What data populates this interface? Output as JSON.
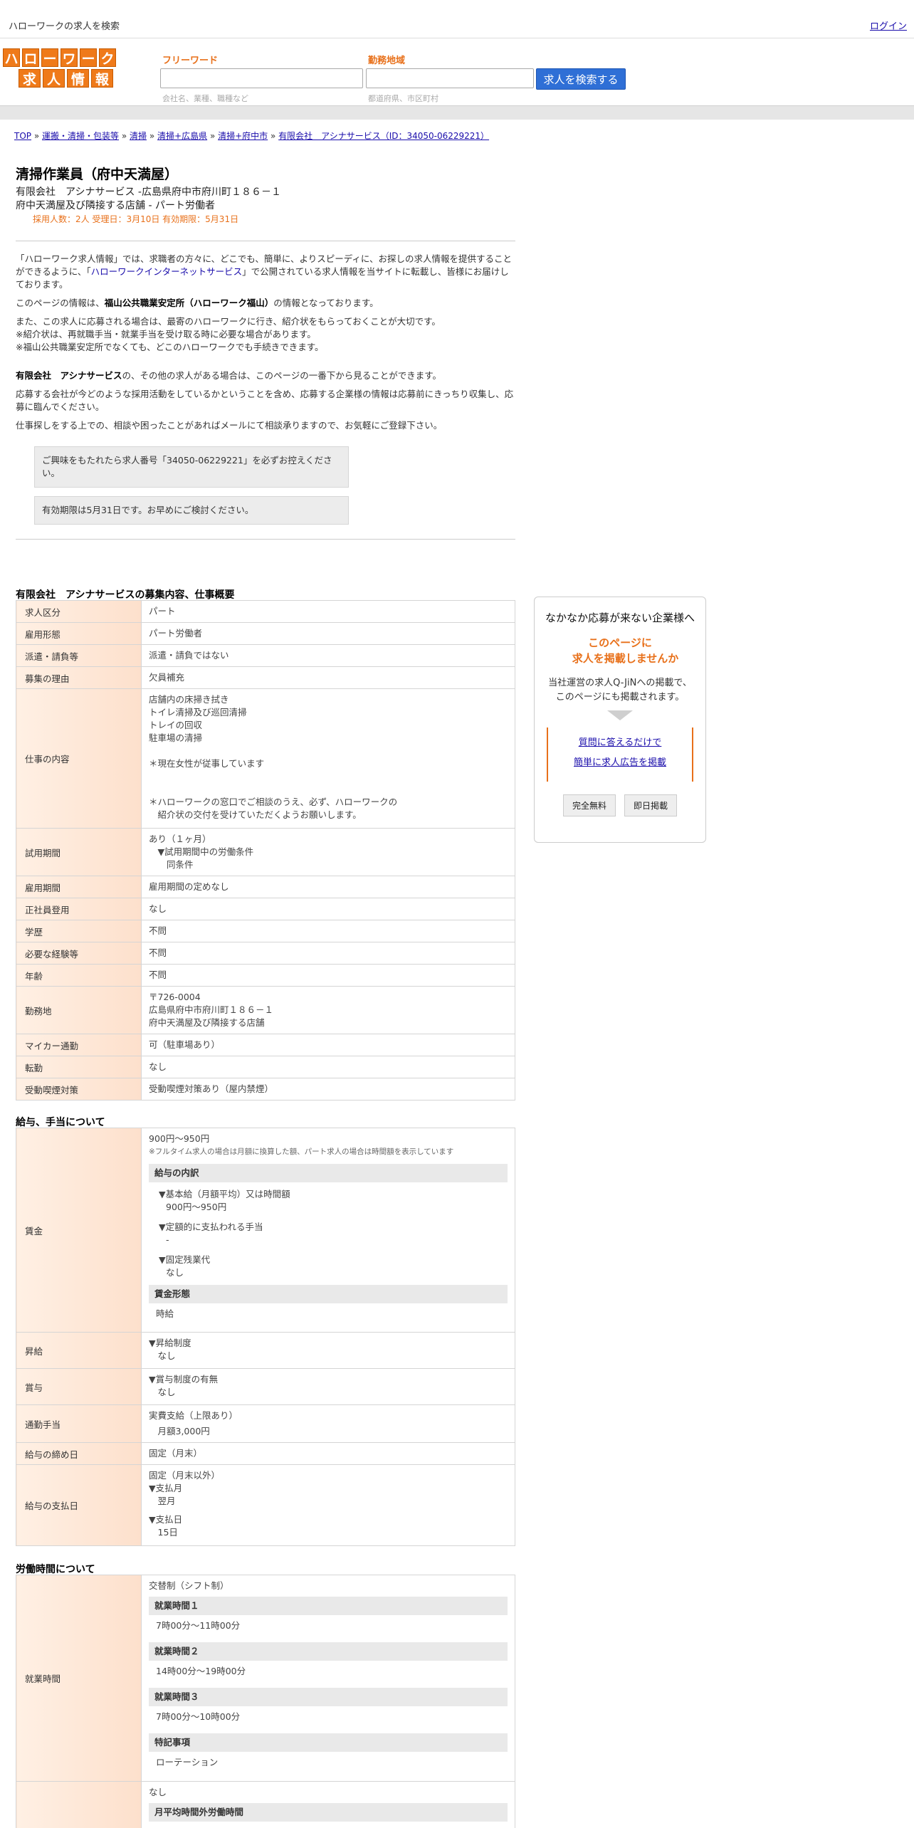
{
  "topbar": {
    "site_title": "ハローワークの求人を検索",
    "login": "ログイン"
  },
  "logo": {
    "row1": [
      "ハ",
      "ロ",
      "ー",
      "ワ",
      "ー",
      "ク"
    ],
    "row2": [
      "求",
      "人",
      "情",
      "報"
    ]
  },
  "search": {
    "keyword_label": "フリーワード",
    "keyword_placeholder": "会社名、業種、職種など",
    "area_label": "勤務地域",
    "area_placeholder": "都道府県、市区町村",
    "button": "求人を検索する"
  },
  "breadcrumb": {
    "items": [
      "TOP",
      "運搬・清掃・包装等",
      "清掃",
      "清掃+広島県",
      "清掃+府中市",
      "有限会社　アシナサービス（ID：34050-06229221）"
    ],
    "sep": "»"
  },
  "job": {
    "title": "清掃作業員（府中天満屋）",
    "company_line": "有限会社　アシナサービス -広島県府中市府川町１８６－１",
    "workplace_line": "府中天満屋及び隣接する店舗 - パート労働者",
    "meta": "採用人数：2人  受理日：3月10日  有効期限：5月31日"
  },
  "intro": {
    "p1_a": "「ハローワーク求人情報」では、求職者の方々に、どこでも、簡単に、よりスピーディに、お探しの求人情報を提供することができるように、「",
    "p1_link": "ハローワークインターネットサービス",
    "p1_b": "」で公開されている求人情報を当サイトに転載し、皆様にお届けしております。",
    "p2_a": "このページの情報は、",
    "p2_b": "福山公共職業安定所（ハローワーク福山）",
    "p2_c": "の情報となっております。",
    "p3_1": "また、この求人に応募される場合は、最寄のハローワークに行き、紹介状をもらっておくことが大切です。",
    "p3_2": "※紹介状は、再就職手当・就業手当を受け取る時に必要な場合があります。",
    "p3_3": "※福山公共職業安定所でなくても、どこのハローワークでも手続きできます。",
    "p4_a": "有限会社　アシナサービス",
    "p4_b": "の、その他の求人がある場合は、このページの一番下から見ることができます。",
    "p5": "応募する会社が今どのような採用活動をしているかということを含め、応募する企業様の情報は応募前にきっちり収集し、応募に臨んでください。",
    "p6": "仕事探しをする上での、相談や困ったことがあればメールにて相談承りますので、お気軽にご登録下さい。",
    "notice1": "ご興味をもたれたら求人番号「34050-06229221」を必ずお控えください。",
    "notice2": "有効期限は5月31日です。お早めにご検討ください。"
  },
  "summary": {
    "title": "有限会社　アシナサービスの募集内容、仕事概要",
    "rows": [
      {
        "label": "求人区分",
        "value": "パート"
      },
      {
        "label": "雇用形態",
        "value": "パート労働者"
      },
      {
        "label": "派遣・請負等",
        "value": "派遣・請負ではない"
      },
      {
        "label": "募集の理由",
        "value": "欠員補充"
      },
      {
        "label": "仕事の内容",
        "lines": [
          "店舗内の床掃き拭き",
          "トイレ清掃及び巡回清掃",
          "トレイの回収",
          "駐車場の清掃",
          "",
          "＊現在女性が従事しています",
          "",
          "",
          "＊ハローワークの窓口でご相談のうえ、必ず、ハローワークの",
          "　紹介状の交付を受けていただくようお願いします。"
        ]
      },
      {
        "label": "試用期間",
        "lines": [
          "あり（１ヶ月）",
          "　▼試用期間中の労働条件",
          "　　同条件"
        ]
      },
      {
        "label": "雇用期間",
        "value": "雇用期間の定めなし"
      },
      {
        "label": "正社員登用",
        "value": "なし"
      },
      {
        "label": "学歴",
        "value": "不問"
      },
      {
        "label": "必要な経験等",
        "value": "不問"
      },
      {
        "label": "年齢",
        "value": "不問"
      },
      {
        "label": "勤務地",
        "lines": [
          "〒726-0004",
          "広島県府中市府川町１８６－１",
          "府中天満屋及び隣接する店舗"
        ]
      },
      {
        "label": "マイカー通勤",
        "value": "可（駐車場あり）"
      },
      {
        "label": "転勤",
        "value": "なし"
      },
      {
        "label": "受動喫煙対策",
        "value": "受動喫煙対策あり（屋内禁煙）"
      }
    ]
  },
  "salary": {
    "title": "給与、手当について",
    "wage_label": "賃金",
    "wage_value": "900円〜950円",
    "wage_note": "※フルタイム求人の場合は月額に換算した額、パート求人の場合は時間額を表示しています",
    "breakdown_hdr": "給与の内訳",
    "base_label": "▼基本給（月額平均）又は時間額",
    "base_value": "900円〜950円",
    "fixed_label": "▼定額的に支払われる手当",
    "fixed_value": "-",
    "overtime_label": "▼固定残業代",
    "overtime_value": "なし",
    "form_hdr": "賃金形態",
    "form_value": "時給",
    "raise_label": "昇給",
    "raise_lines": [
      "▼昇給制度",
      "　なし"
    ],
    "bonus_label": "賞与",
    "bonus_lines": [
      "▼賞与制度の有無",
      "　なし"
    ],
    "commute_label": "通勤手当",
    "commute_lines": [
      "実費支給（上限あり）",
      "　月額3,000円"
    ],
    "close_label": "給与の締め日",
    "close_value": "固定（月末）",
    "pay_label": "給与の支払日",
    "pay_lines": [
      "固定（月末以外）",
      "▼支払月",
      "　翌月"
    ],
    "pay_lines2": [
      "▼支払日",
      "　15日"
    ]
  },
  "hours": {
    "title": "労働時間について",
    "label": "就業時間",
    "system": "交替制（シフト制）",
    "h1_hdr": "就業時間１",
    "h1": "7時00分〜11時00分",
    "h2_hdr": "就業時間２",
    "h2": "14時00分〜19時00分",
    "h3_hdr": "就業時間３",
    "h3": "7時00分〜10時00分",
    "note_hdr": "特記事項",
    "note": "ローテーション",
    "ot_value": "なし",
    "ot_hdr": "月平均時間外労働時間"
  },
  "sidebox": {
    "title": "なかなか応募が来ない企業様へ",
    "catch1": "このページに",
    "catch2": "　求人を掲載しませんか",
    "desc1": "当社運営の求人Q-JiNへの掲載で、",
    "desc2": "このページにも掲載されます。",
    "link1": "質問に答えるだけで",
    "link2": "簡単に求人広告を掲載",
    "badge1": "完全無料",
    "badge2": "即日掲載"
  }
}
